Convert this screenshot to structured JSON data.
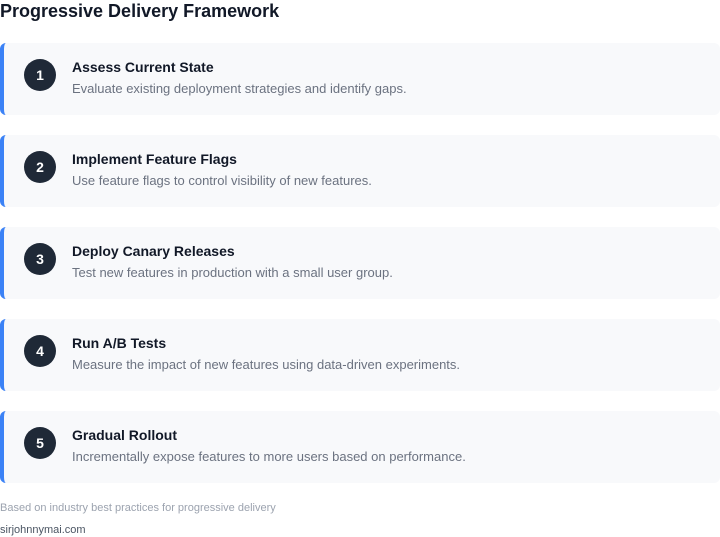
{
  "title": "Progressive Delivery Framework",
  "steps": [
    {
      "number": "1",
      "title": "Assess Current State",
      "description": "Evaluate existing deployment strategies and identify gaps."
    },
    {
      "number": "2",
      "title": "Implement Feature Flags",
      "description": "Use feature flags to control visibility of new features."
    },
    {
      "number": "3",
      "title": "Deploy Canary Releases",
      "description": "Test new features in production with a small user group."
    },
    {
      "number": "4",
      "title": "Run A/B Tests",
      "description": "Measure the impact of new features using data-driven experiments."
    },
    {
      "number": "5",
      "title": "Gradual Rollout",
      "description": "Incrementally expose features to more users based on performance."
    }
  ],
  "footnote": "Based on industry best practices for progressive delivery",
  "site": "sirjohnnymai.com",
  "colors": {
    "accent": "#3b82f6",
    "badge": "#1f2937",
    "card_background": "#f8f9fb"
  }
}
